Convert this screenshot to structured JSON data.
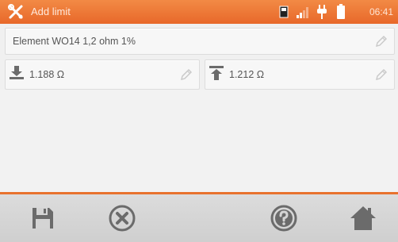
{
  "header": {
    "title": "Add limit",
    "time": "06:41",
    "icons": [
      "tool-icon",
      "memory-card-icon",
      "signal-icon",
      "plug-icon",
      "battery-icon"
    ]
  },
  "element_field": {
    "value": "Element WO14 1,2 ohm 1%"
  },
  "limits": {
    "lower": {
      "value": "1.188 Ω",
      "icon": "lower-limit-icon"
    },
    "upper": {
      "value": "1.212 Ω",
      "icon": "upper-limit-icon"
    }
  },
  "toolbar": {
    "icons": [
      "save-icon",
      "cancel-icon",
      "help-icon",
      "home-icon"
    ]
  },
  "colors": {
    "accent": "#e8722e",
    "background": "#f0f0f0",
    "toolbar": "#d4d4d4",
    "icon": "#6b6b6b"
  }
}
